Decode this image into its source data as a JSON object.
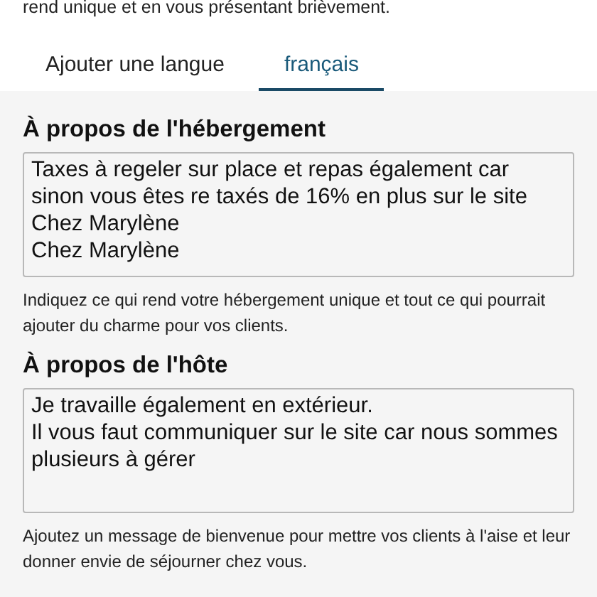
{
  "intro": "rend unique et en vous présentant brièvement.",
  "tabs": [
    {
      "label": "Ajouter une langue",
      "selected": false
    },
    {
      "label": "français",
      "selected": true
    }
  ],
  "sections": [
    {
      "title": "À propos de l'hébergement",
      "value": "Taxes à regeler sur place et repas également car sinon vous êtes re taxés de 16% en plus sur le site\nChez Marylène\nChez Marylène",
      "help": "Indiquez ce qui rend votre hébergement unique et tout ce qui pourrait ajouter du charme pour vos clients."
    },
    {
      "title": "À propos de l'hôte",
      "value": "Je travaille également en extérieur.\nIl vous faut communiquer sur le site car nous sommes plusieurs à gérer",
      "help": "Ajoutez un message de bienvenue pour mettre vos clients à l'aise et leur donner envie de séjourner chez vous."
    }
  ]
}
